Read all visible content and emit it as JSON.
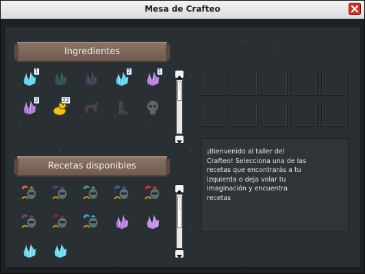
{
  "window": {
    "title": "Mesa de Crafteo"
  },
  "ingredients": {
    "title": "Ingredientes",
    "items": [
      {
        "name": "crystal-blue-icon",
        "count": "1",
        "faded": false,
        "color": "#5fd1e6"
      },
      {
        "name": "crystal-teal-icon",
        "count": "",
        "faded": true,
        "color": "#3a8f8a"
      },
      {
        "name": "crystal-purple-dark-icon",
        "count": "",
        "faded": true,
        "color": "#6d5a8c"
      },
      {
        "name": "crystal-blue-small-icon",
        "count": "2",
        "faded": false,
        "color": "#5fd1e6"
      },
      {
        "name": "crystal-purple-icon",
        "count": "1",
        "faded": false,
        "color": "#b07ad8"
      },
      {
        "name": "crystal-purple-small-icon",
        "count": "2",
        "faded": false,
        "color": "#a874d6"
      },
      {
        "name": "rubber-duck-icon",
        "count": "22",
        "faded": false,
        "color": "#f2c21b"
      },
      {
        "name": "horse-icon",
        "count": "",
        "faded": true,
        "color": "#8a6a4c"
      },
      {
        "name": "boot-icon",
        "count": "",
        "faded": true,
        "color": "#7b6a5c"
      },
      {
        "name": "skull-icon",
        "count": "",
        "faded": true,
        "color": "#c9c9c9"
      }
    ]
  },
  "recipes": {
    "title": "Recetas disponibles",
    "items": [
      {
        "name": "helmet-feathered-icon",
        "color": "#d46b3a"
      },
      {
        "name": "helmet-dark-horned-icon",
        "color": "#5a3f7a"
      },
      {
        "name": "helmet-green-icon",
        "color": "#4fa06a"
      },
      {
        "name": "helmet-blue-horned-icon",
        "color": "#3c5cb0"
      },
      {
        "name": "helmet-red-crest-icon",
        "color": "#c9392f"
      },
      {
        "name": "helmet-purple-leaf-icon",
        "color": "#6b4a7e"
      },
      {
        "name": "helmet-maroon-icon",
        "color": "#7a2f3a"
      },
      {
        "name": "helmet-cyan-icon",
        "color": "#3fa2c8"
      },
      {
        "name": "crystal-cluster-purple-icon",
        "color": "#b07ad8"
      },
      {
        "name": "crystal-cluster-violet-icon",
        "color": "#c08ae0"
      },
      {
        "name": "crystal-cluster-blue-icon",
        "color": "#6fd6ea"
      },
      {
        "name": "crystal-cluster-cyan-icon",
        "color": "#6fd6ea"
      }
    ]
  },
  "info": {
    "text": "¡Bienvenido al taller del Crafteo! Selecciona una de las recetas que encontrarás a tu izquierda o deja volar tu imaginación y encuentra recetas"
  }
}
